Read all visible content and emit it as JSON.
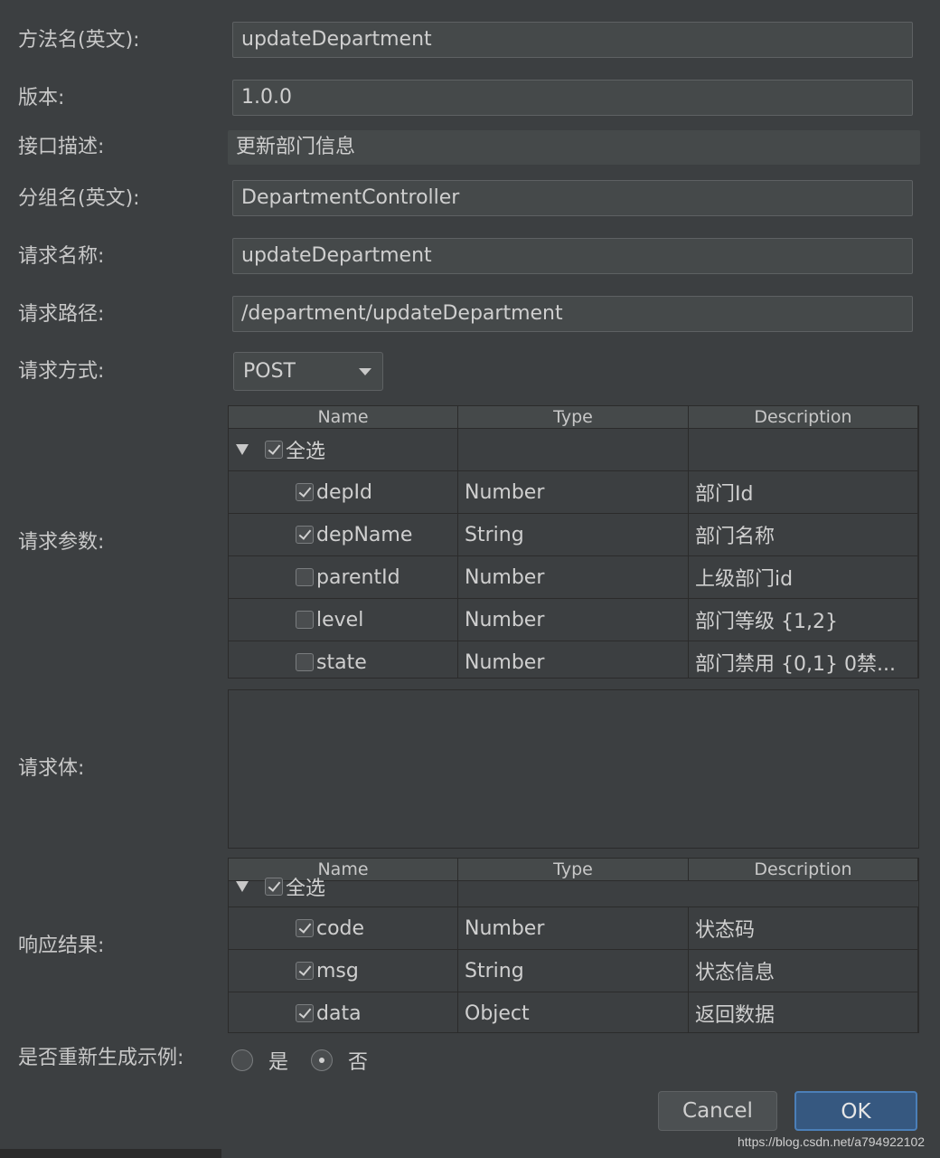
{
  "form": {
    "method_name_label": "方法名(英文):",
    "method_name_value": "updateDepartment",
    "version_label": "版本:",
    "version_value": "1.0.0",
    "desc_label": "接口描述:",
    "desc_value": "更新部门信息",
    "group_label": "分组名(英文):",
    "group_value": "DepartmentController",
    "req_name_label": "请求名称:",
    "req_name_value": "updateDepartment",
    "req_path_label": "请求路径:",
    "req_path_value": "/department/updateDepartment",
    "req_method_label": "请求方式:",
    "req_method_value": "POST",
    "req_params_label": "请求参数:",
    "req_body_label": "请求体:",
    "resp_label": "响应结果:",
    "regen_label": "是否重新生成示例:",
    "regen_yes": "是",
    "regen_no": "否"
  },
  "table_headers": {
    "name": "Name",
    "type": "Type",
    "description": "Description"
  },
  "params": {
    "select_all": "全选",
    "rows": [
      {
        "name": "depId",
        "type": "Number",
        "desc": "部门Id",
        "checked": true
      },
      {
        "name": "depName",
        "type": "String",
        "desc": "部门名称",
        "checked": true
      },
      {
        "name": "parentId",
        "type": "Number",
        "desc": "上级部门id",
        "checked": false
      },
      {
        "name": "level",
        "type": "Number",
        "desc": "部门等级 {1,2}",
        "checked": false
      },
      {
        "name": "state",
        "type": "Number",
        "desc": "部门禁用 {0,1} 0禁...",
        "checked": false
      }
    ]
  },
  "response": {
    "select_all": "全选",
    "rows": [
      {
        "name": "code",
        "type": "Number",
        "desc": "状态码",
        "checked": true
      },
      {
        "name": "msg",
        "type": "String",
        "desc": "状态信息",
        "checked": true
      },
      {
        "name": "data",
        "type": "Object",
        "desc": "返回数据",
        "checked": true
      }
    ]
  },
  "buttons": {
    "cancel": "Cancel",
    "ok": "OK"
  },
  "watermark": "https://blog.csdn.net/a794922102"
}
